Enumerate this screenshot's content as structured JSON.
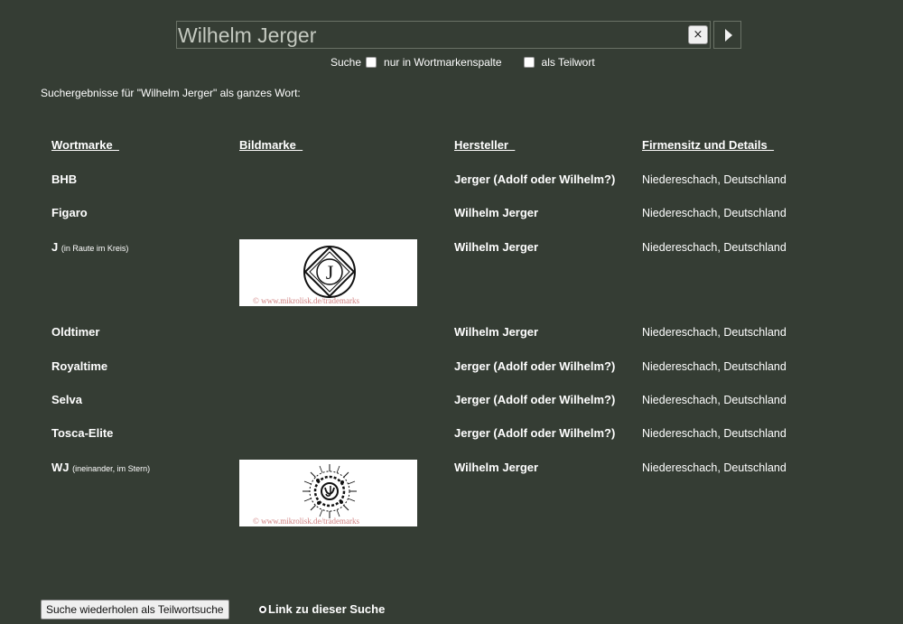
{
  "search": {
    "value": "Wilhelm Jerger",
    "clear_label": "×",
    "go_icon": "play-triangle-icon"
  },
  "options": {
    "suche_label": "Suche",
    "wortmarken_label": "nur in Wortmarkenspalte",
    "teilwort_label": "als Teilwort"
  },
  "summary": "Suchergebnisse für \"Wilhelm Jerger\" als ganzes Wort:",
  "table": {
    "headers": {
      "wortmarke": "Wortmarke_",
      "bildmarke": "Bildmarke_",
      "hersteller": "Hersteller_",
      "firmensitz": "Firmensitz und Details_"
    },
    "rows": [
      {
        "wortmarke": "BHB",
        "note": "",
        "hersteller": "Jerger (Adolf oder Wilhelm?)",
        "firmensitz": "Niedereschach, Deutschland"
      },
      {
        "wortmarke": "Figaro",
        "note": "",
        "hersteller": "Wilhelm Jerger",
        "firmensitz": "Niedereschach, Deutschland"
      },
      {
        "wortmarke": "J",
        "note": "(in Raute im Kreis)",
        "hersteller": "Wilhelm Jerger",
        "firmensitz": "Niedereschach, Deutschland"
      },
      {
        "wortmarke": "Oldtimer",
        "note": "",
        "hersteller": "Wilhelm Jerger",
        "firmensitz": "Niedereschach, Deutschland"
      },
      {
        "wortmarke": "Royaltime",
        "note": "",
        "hersteller": "Jerger (Adolf oder Wilhelm?)",
        "firmensitz": "Niedereschach, Deutschland"
      },
      {
        "wortmarke": "Selva",
        "note": "",
        "hersteller": "Jerger (Adolf oder Wilhelm?)",
        "firmensitz": "Niedereschach, Deutschland"
      },
      {
        "wortmarke": "Tosca-Elite",
        "note": "",
        "hersteller": "Jerger (Adolf oder Wilhelm?)",
        "firmensitz": "Niedereschach, Deutschland"
      },
      {
        "wortmarke": "WJ",
        "note": "(ineinander, im Stern)",
        "hersteller": "Wilhelm Jerger",
        "firmensitz": "Niedereschach, Deutschland"
      }
    ]
  },
  "images": {
    "j_logo_letter": "J",
    "credit": "© www.mikrolisk.de/trademarks"
  },
  "footer": {
    "repeat_button": "Suche wiederholen als Teilwortsuche",
    "link_label": "Link zu dieser Suche",
    "link_icon": "link-icon"
  }
}
